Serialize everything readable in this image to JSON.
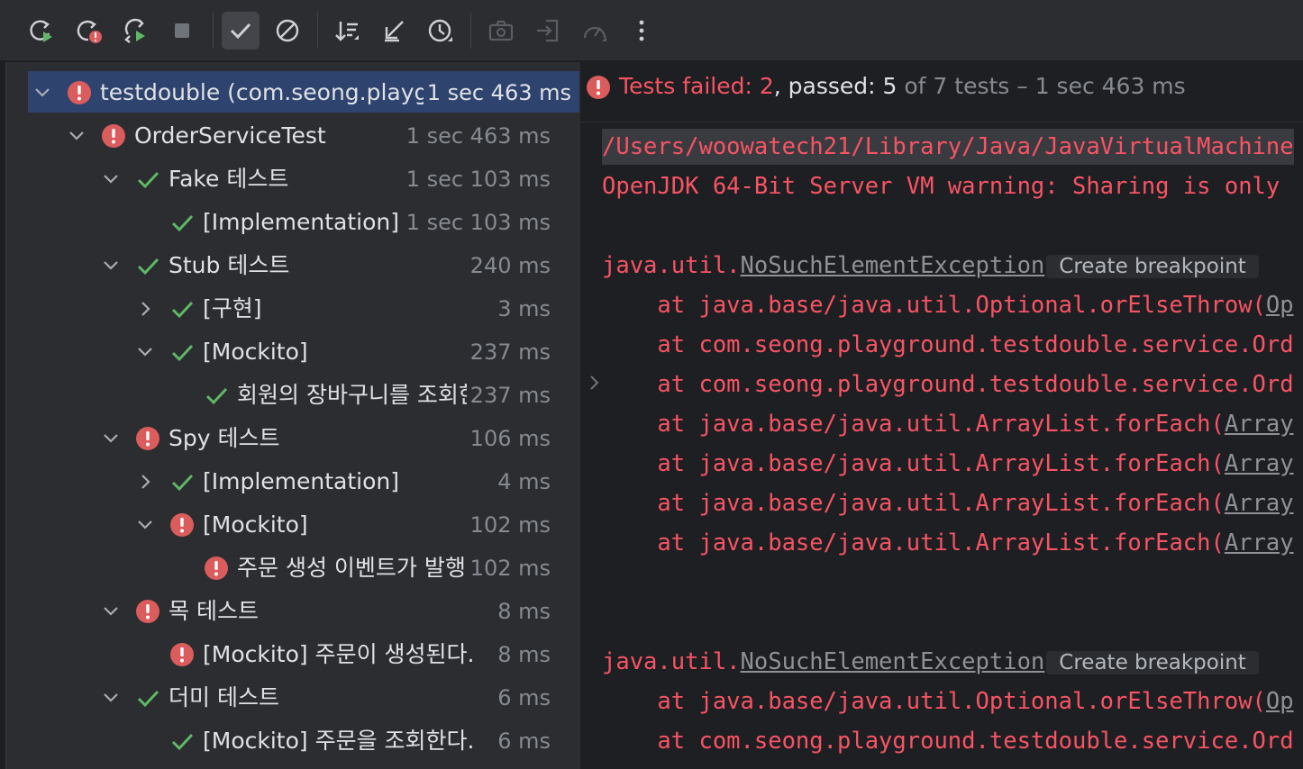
{
  "toolbar": {
    "buttons": [
      {
        "name": "rerun-icon"
      },
      {
        "name": "rerun-failed-icon"
      },
      {
        "name": "toggle-auto-test-icon"
      },
      {
        "name": "stop-icon"
      },
      {
        "name": "show-passed-icon"
      },
      {
        "name": "show-ignored-icon"
      },
      {
        "name": "sort-alphabetically-icon"
      },
      {
        "name": "collapse-all-icon"
      },
      {
        "name": "sort-by-duration-icon"
      },
      {
        "name": "camera-icon"
      },
      {
        "name": "import-tests-icon"
      },
      {
        "name": "speedometer-icon"
      },
      {
        "name": "more-options-icon"
      }
    ]
  },
  "tree": {
    "rows": [
      {
        "label": "testdouble (com.seong.playg",
        "duration": "1 sec 463 ms",
        "status": "error",
        "expand": "down",
        "depth": 0,
        "selected": true
      },
      {
        "label": "OrderServiceTest",
        "duration": "1 sec 463 ms",
        "status": "error",
        "expand": "down",
        "depth": 1
      },
      {
        "label": "Fake 테스트",
        "duration": "1 sec 103 ms",
        "status": "pass",
        "expand": "down",
        "depth": 2
      },
      {
        "label": "[Implementation] 주문",
        "duration": "1 sec 103 ms",
        "status": "pass",
        "expand": "none",
        "depth": 3
      },
      {
        "label": "Stub 테스트",
        "duration": "240 ms",
        "status": "pass",
        "expand": "down",
        "depth": 2
      },
      {
        "label": "[구현]",
        "duration": "3 ms",
        "status": "pass",
        "expand": "right",
        "depth": 3
      },
      {
        "label": "[Mockito]",
        "duration": "237 ms",
        "status": "pass",
        "expand": "down",
        "depth": 3
      },
      {
        "label": "회원의 장바구니를 조회한",
        "duration": "237 ms",
        "status": "pass",
        "expand": "none",
        "depth": 4
      },
      {
        "label": "Spy 테스트",
        "duration": "106 ms",
        "status": "error",
        "expand": "down",
        "depth": 2
      },
      {
        "label": "[Implementation]",
        "duration": "4 ms",
        "status": "pass",
        "expand": "right",
        "depth": 3
      },
      {
        "label": "[Mockito]",
        "duration": "102 ms",
        "status": "error",
        "expand": "down",
        "depth": 3
      },
      {
        "label": "주문 생성 이벤트가 발행된",
        "duration": "102 ms",
        "status": "error",
        "expand": "none",
        "depth": 4
      },
      {
        "label": "목 테스트",
        "duration": "8 ms",
        "status": "error",
        "expand": "down",
        "depth": 2
      },
      {
        "label": "[Mockito] 주문이 생성된다.",
        "duration": "8 ms",
        "status": "error",
        "expand": "none",
        "depth": 3
      },
      {
        "label": "더미 테스트",
        "duration": "6 ms",
        "status": "pass",
        "expand": "down",
        "depth": 2
      },
      {
        "label": "[Mockito] 주문을 조회한다.",
        "duration": "6 ms",
        "status": "pass",
        "expand": "none",
        "depth": 3
      }
    ]
  },
  "status_bar": {
    "failed_label": "Tests failed: ",
    "failed_count": "2",
    "passed_label": ", passed: ",
    "passed_count": "5",
    "rest": " of 7 tests – 1 sec 463 ms"
  },
  "console": {
    "path_line": "/Users/woowatech21/Library/Java/JavaVirtualMachine",
    "warning_line": "OpenJDK 64-Bit Server VM warning: Sharing is only",
    "exception_prefix": "java.util.",
    "exception_name": "NoSuchElementException",
    "breakpoint_label": "Create breakpoint",
    "trace1": [
      {
        "text": "    at java.base/java.util.Optional.orElseThrow(",
        "link": "Op"
      },
      {
        "text": "    at com.seong.playground.testdouble.service.Ord",
        "link": ""
      },
      {
        "text": "    at com.seong.playground.testdouble.service.Ord",
        "link": ""
      },
      {
        "text": "    at java.base/java.util.ArrayList.forEach(",
        "link": "Array"
      },
      {
        "text": "    at java.base/java.util.ArrayList.forEach(",
        "link": "Array"
      },
      {
        "text": "    at java.base/java.util.ArrayList.forEach(",
        "link": "Array"
      },
      {
        "text": "    at java.base/java.util.ArrayList.forEach(",
        "link": "Array"
      }
    ],
    "trace2": [
      {
        "text": "    at java.base/java.util.Optional.orElseThrow(",
        "link": "Op"
      },
      {
        "text": "    at com.seong.playground.testdouble.service.Ord",
        "link": ""
      }
    ]
  },
  "colors": {
    "error": "#db5c5c",
    "pass": "#5fb865",
    "console_error": "#f75464"
  }
}
